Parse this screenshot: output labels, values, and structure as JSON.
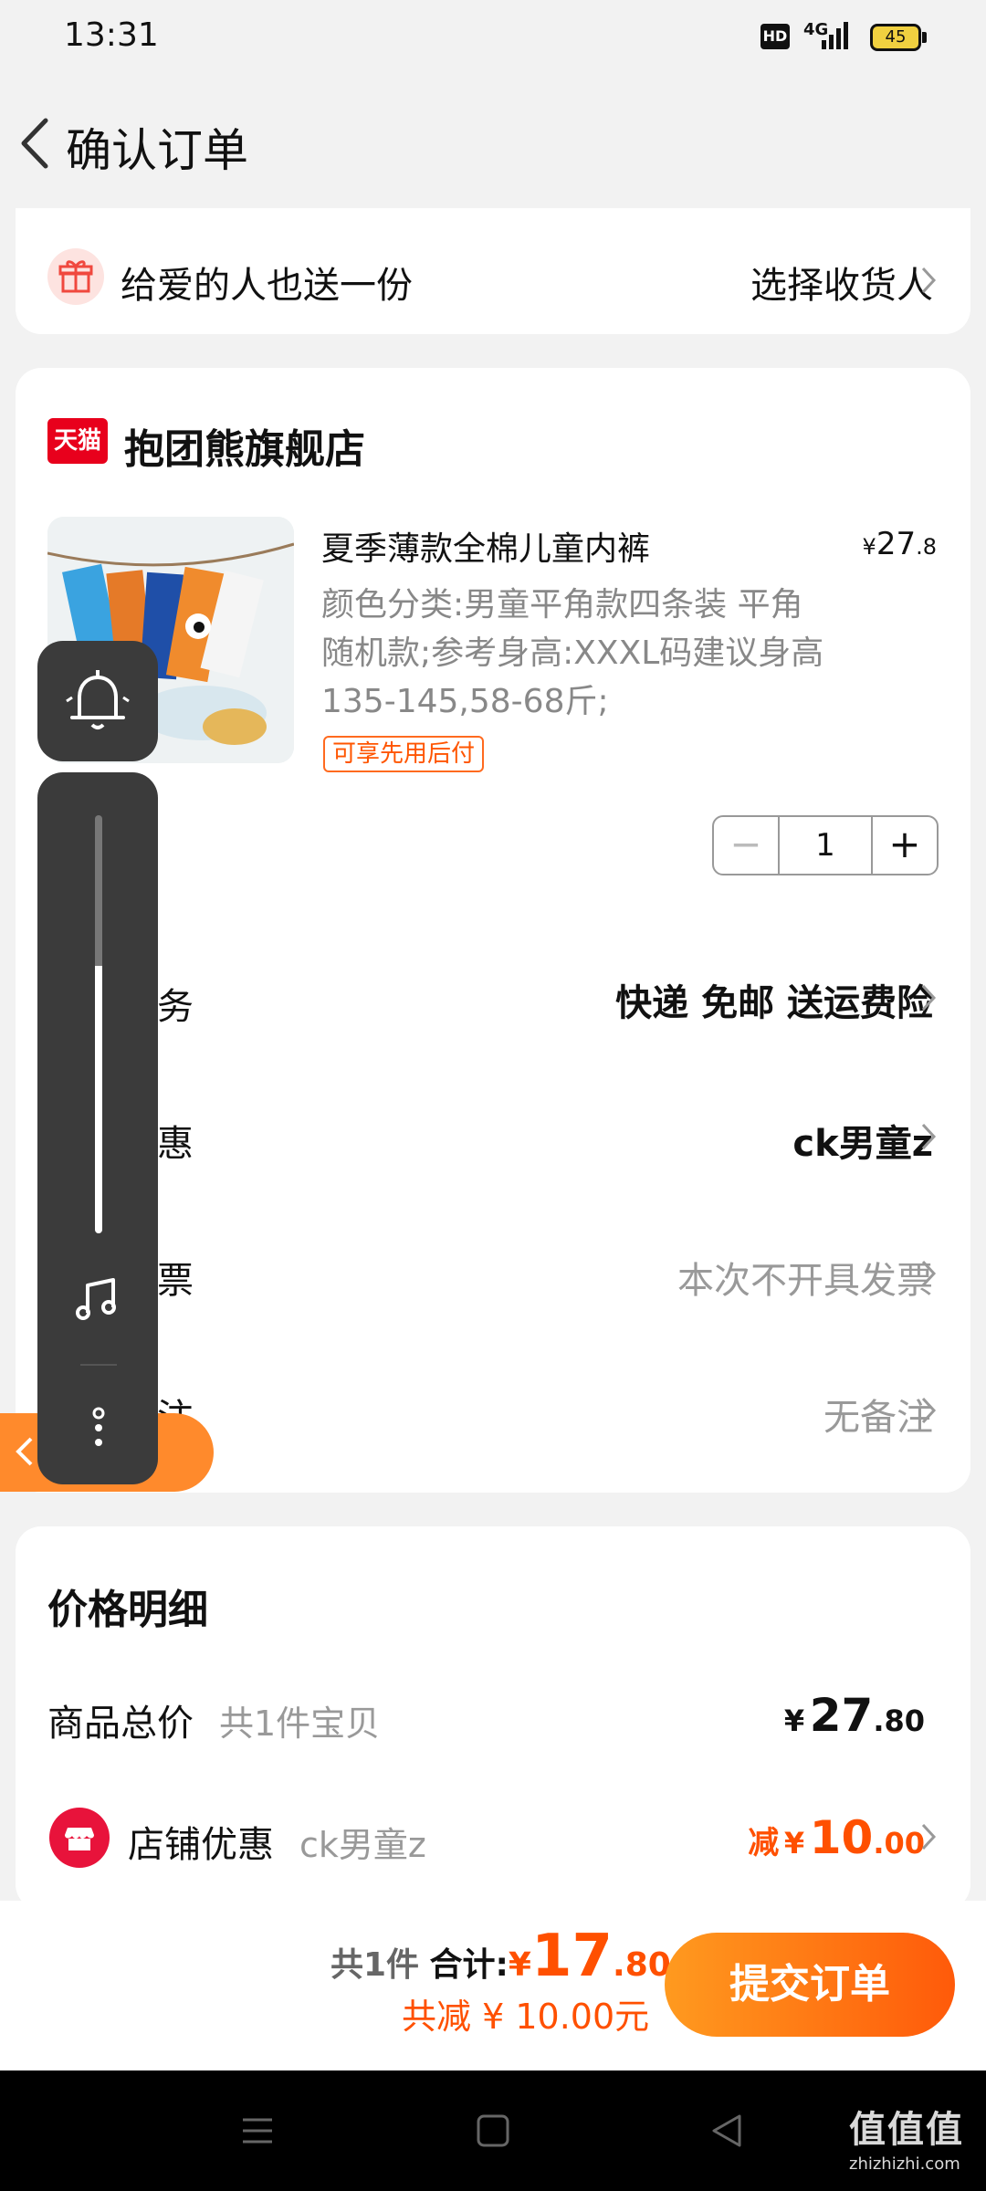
{
  "status_bar": {
    "time": "13:31",
    "hd": "HD",
    "network": "4G",
    "battery": "45"
  },
  "header": {
    "title": "确认订单"
  },
  "gift": {
    "label": "给爱的人也送一份",
    "action": "选择收货人"
  },
  "store": {
    "platform_badge": "天猫",
    "name": "抱团熊旗舰店"
  },
  "product": {
    "title": "夏季薄款全棉儿童内裤",
    "price_currency": "¥",
    "price_int": "27",
    "price_dec": ".8",
    "spec": "颜色分类:男童平角款四条装 平角随机款;参考身高:XXXL码建议身高135-145,58-68斤;",
    "tag": "可享先用后付",
    "quantity": "1"
  },
  "rows": {
    "delivery": {
      "label": "配送服务",
      "value": "快递 免邮 送运费险"
    },
    "store_discount": {
      "label": "店铺优惠",
      "value": "ck男童z"
    },
    "invoice": {
      "label": "开具发票",
      "value": "本次不开具发票"
    },
    "note": {
      "label": "订单备注",
      "value": "无备注"
    }
  },
  "overlay": {
    "return_label": "返回",
    "volume_level": 0.64
  },
  "price_detail": {
    "heading": "价格明细",
    "total_label": "商品总价",
    "total_count": "共1件宝贝",
    "total_currency": "¥",
    "total_int": "27",
    "total_dec": ".80",
    "discount_label": "店铺优惠",
    "discount_code": "ck男童z",
    "discount_prefix": "减",
    "discount_currency": "¥",
    "discount_int": "10",
    "discount_dec": ".00"
  },
  "submit": {
    "count_text": "共1件",
    "sum_label": "合计:",
    "currency": "¥",
    "sum_int": "17",
    "sum_dec": ".80",
    "saved_text": "共减 ¥ 10.00元",
    "button_label": "提交订单"
  },
  "watermark": {
    "logo": "值值值",
    "url": "zhizhizhi.com"
  },
  "colors": {
    "accent": "#ff5000",
    "tmall_red": "#e8001c",
    "overlay_bg": "#3b3b3b"
  }
}
